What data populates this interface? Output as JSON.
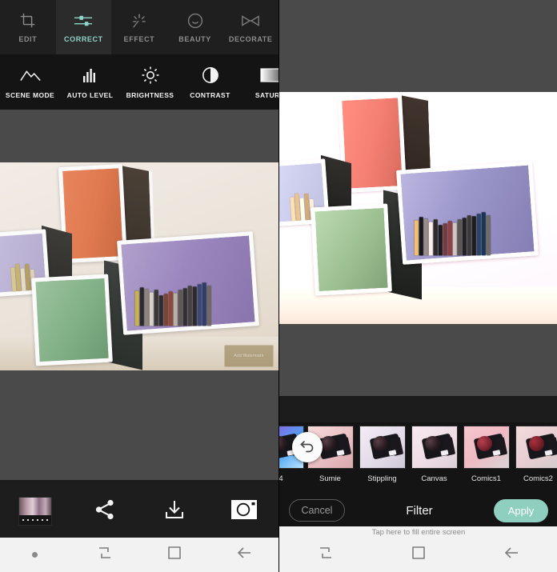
{
  "left_panel": {
    "tabs": [
      {
        "label": "EDIT",
        "icon": "crop-icon",
        "active": false
      },
      {
        "label": "CORRECT",
        "icon": "sliders-icon",
        "active": true
      },
      {
        "label": "EFFECT",
        "icon": "sparkle-icon",
        "active": false
      },
      {
        "label": "BEAUTY",
        "icon": "smiley-icon",
        "active": false
      },
      {
        "label": "DECORATE",
        "icon": "bowtie-icon",
        "active": false
      }
    ],
    "adjustments": [
      {
        "label": "SCENE MODE",
        "icon": "mountain-icon"
      },
      {
        "label": "AUTO LEVEL",
        "icon": "histogram-icon"
      },
      {
        "label": "BRIGHTNESS",
        "icon": "sun-icon"
      },
      {
        "label": "CONTRAST",
        "icon": "contrast-icon"
      },
      {
        "label": "SATURA",
        "icon": "gradient-square-icon"
      }
    ],
    "history_controls": [
      {
        "name": "undo-button",
        "icon": "arrow-left-icon"
      },
      {
        "name": "redo-button",
        "icon": "arrow-right-icon"
      },
      {
        "name": "reset-button",
        "icon": "history-clock-icon"
      }
    ],
    "actions": [
      {
        "name": "gallery-thumbnail-button",
        "icon": "filmstrip-thumbnail-icon"
      },
      {
        "name": "share-button",
        "icon": "share-icon"
      },
      {
        "name": "save-button",
        "icon": "download-icon"
      },
      {
        "name": "camera-button",
        "icon": "camera-icon"
      }
    ],
    "photo": {
      "watermark": "Add Watermark"
    },
    "navbar": [
      {
        "name": "nav-dot",
        "icon": "dot-icon"
      },
      {
        "name": "nav-recents",
        "icon": "recents-icon"
      },
      {
        "name": "nav-home",
        "icon": "home-square-icon"
      },
      {
        "name": "nav-back",
        "icon": "back-arrow-icon"
      }
    ]
  },
  "right_panel": {
    "filters": [
      {
        "label": "4",
        "cut": true,
        "tint": "#b9d8f2"
      },
      {
        "label": "Sumie",
        "cut": false,
        "tint": "#f2d7d9"
      },
      {
        "label": "Stippling",
        "cut": false,
        "tint": "#e6e0ea"
      },
      {
        "label": "Canvas",
        "cut": false,
        "tint": "#efe3ea"
      },
      {
        "label": "Comics1",
        "cut": false,
        "tint": "#f0c9cf"
      },
      {
        "label": "Comics2",
        "cut": false,
        "tint": "#efd9da"
      }
    ],
    "undo_fab": {
      "name": "filter-undo-button",
      "icon": "undo-arrow-icon"
    },
    "action_bar": {
      "cancel_label": "Cancel",
      "title": "Filter",
      "apply_label": "Apply"
    },
    "hint": "Tap here to fill entire screen",
    "navbar": [
      {
        "name": "nav-recents",
        "icon": "recents-icon"
      },
      {
        "name": "nav-home",
        "icon": "home-square-icon"
      },
      {
        "name": "nav-back",
        "icon": "back-arrow-icon"
      }
    ]
  },
  "colors": {
    "accent_teal": "#8fd4c8",
    "apply_button": "#8ecfc0",
    "canvas_gray": "#4a4a4a",
    "toolbar_dark": "#141414",
    "navbar_light": "#f2f2f2"
  }
}
